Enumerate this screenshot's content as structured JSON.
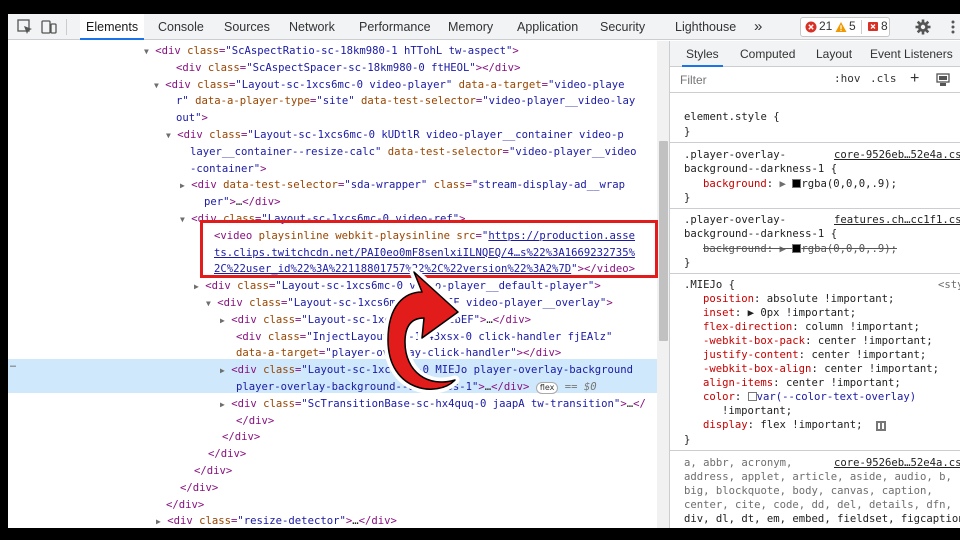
{
  "toolbar": {
    "tabs": [
      "Elements",
      "Console",
      "Sources",
      "Network",
      "Performance",
      "Memory",
      "Application",
      "Security",
      "Lighthouse"
    ],
    "more": "»",
    "errors": "21",
    "warnings": "5",
    "issues": "8"
  },
  "elements": {
    "lines": [
      {
        "ind": 146,
        "tri": "▼",
        "html": "<span class='tag'>&lt;div</span> <span class='an'>class</span>=<span class='av'>\"ScAspectRatio-sc-18km980-1 hTTohL tw-aspect\"</span><span class='tag'>&gt;</span>"
      },
      {
        "ind": 168,
        "tri": "",
        "html": "<span class='tag'>&lt;div</span> <span class='an'>class</span>=<span class='av'>\"ScAspectSpacer-sc-18km980-0 ftHEOL\"</span><span class='tag'>&gt;&lt;/div&gt;</span>"
      },
      {
        "ind": 156,
        "tri": "▼",
        "html": "<span class='tag'>&lt;div</span> <span class='an'>class</span>=<span class='av'>\"Layout-sc-1xcs6mc-0 video-player\"</span> <span class='an'>data-a-target</span>=<span class='av'>\"video-playe</span>"
      },
      {
        "ind": 168,
        "tri": "",
        "html": "<span class='av'>r\"</span> <span class='an'>data-a-player-type</span>=<span class='av'>\"site\"</span> <span class='an'>data-test-selector</span>=<span class='av'>\"video-player__video-lay</span>"
      },
      {
        "ind": 168,
        "tri": "",
        "html": "<span class='av'>out\"</span><span class='tag'>&gt;</span>"
      },
      {
        "ind": 168,
        "tri": "▼",
        "html": "<span class='tag'>&lt;div</span> <span class='an'>class</span>=<span class='av'>\"Layout-sc-1xcs6mc-0 kUDtlR video-player__container video-p</span>"
      },
      {
        "ind": 182,
        "tri": "",
        "html": "<span class='av'>layer__container--resize-calc\"</span> <span class='an'>data-test-selector</span>=<span class='av'>\"video-player__video</span>"
      },
      {
        "ind": 182,
        "tri": "",
        "html": "<span class='av'>-container\"</span><span class='tag'>&gt;</span>"
      },
      {
        "ind": 182,
        "tri": "▶",
        "html": "<span class='tag'>&lt;div</span> <span class='an'>data-test-selector</span>=<span class='av'>\"sda-wrapper\"</span> <span class='an'>class</span>=<span class='av'>\"stream-display-ad__wrap</span>"
      },
      {
        "ind": 196,
        "tri": "",
        "html": "<span class='av'>per\"</span><span class='tag'>&gt;</span><span class='txt'>…</span><span class='tag'>&lt;/div&gt;</span>"
      },
      {
        "ind": 182,
        "tri": "▼",
        "html": "<span class='tag'>&lt;div</span> <span class='an'>class</span>=<span class='av'>\"Layout-sc-1xcs6mc-0 video-ref\"</span><span class='tag'>&gt;</span>"
      },
      {
        "ind": 206,
        "tri": "",
        "html": "<span class='tag'>&lt;video</span> <span class='an'>playsinline webkit-playsinline src</span>=<span class='av'>\"</span><span class='lnk'>https://production.asse</span>"
      },
      {
        "ind": 206,
        "tri": "",
        "html": "<span class='lnk'>ts.clips.twitchcdn.net/PAI0eo0mF8senlxiILNQEQ/4…s%22%3A1669232735%</span>"
      },
      {
        "ind": 206,
        "tri": "",
        "html": "<span class='lnk'>2C%22user_id%22%3A%22118801757%22%2C%22version%22%3A2%7D</span><span class='av'>\"</span><span class='tag'>&gt;&lt;/video&gt;</span>"
      },
      {
        "ind": 196,
        "tri": "▶",
        "html": "<span class='tag'>&lt;div</span> <span class='an'>class</span>=<span class='av'>\"Layout-sc-1xcs6mc-0 video-player__default-player\"</span><span class='tag'>&gt;</span>"
      },
      {
        "ind": 208,
        "tri": "▼",
        "html": "<span class='tag'>&lt;div</span> <span class='an'>class</span>=<span class='av'>\"Layout-sc-1xcs6mc-0 kfOuIF video-player__overlay\"</span><span class='tag'>&gt;</span>"
      },
      {
        "ind": 222,
        "tri": "▶",
        "html": "<span class='tag'>&lt;div</span> <span class='an'>class</span>=<span class='av'>\"Layout-sc-1xcs6mc-0 fYzbEF\"</span><span class='tag'>&gt;</span><span class='txt'>…</span><span class='tag'>&lt;/div&gt;</span>"
      },
      {
        "ind": 228,
        "tri": "",
        "html": "<span class='tag'>&lt;div</span> <span class='an'>class</span>=<span class='av'>\"InjectLayout-sc-1i43xsx-0 click-handler fjEAlz\"</span>"
      },
      {
        "ind": 228,
        "tri": "",
        "html": "<span class='an'>data-a-target</span>=<span class='av'>\"player-overlay-click-handler\"</span><span class='tag'>&gt;&lt;/div&gt;</span>"
      },
      {
        "ind": 222,
        "tri": "▶",
        "html": "<span class='tag'>&lt;div</span> <span class='an'>class</span>=<span class='av'>\"Layout-sc-1xcs6mc-0 MIEJo player-overlay-background</span>"
      },
      {
        "ind": 228,
        "tri": "",
        "html": "<span class='av'>player-overlay-background--darkness-1\"</span><span class='tag'>&gt;</span><span class='txt'>…</span><span class='tag'>&lt;/div&gt;</span> <span class='flexbadge'>flex</span> <span class='eq'>== $0</span>"
      },
      {
        "ind": 222,
        "tri": "▶",
        "html": "<span class='tag'>&lt;div</span> <span class='an'>class</span>=<span class='av'>\"ScTransitionBase-sc-hx4quq-0 jaapA tw-transition\"</span><span class='tag'>&gt;</span><span class='txt'>…</span><span class='tag'>&lt;/</span>"
      },
      {
        "ind": 228,
        "tri": "",
        "html": "<span class='tag'>&lt;/div&gt;</span>"
      },
      {
        "ind": 214,
        "tri": "",
        "html": "<span class='tag'>&lt;/div&gt;</span>"
      },
      {
        "ind": 200,
        "tri": "",
        "html": "<span class='tag'>&lt;/div&gt;</span>"
      },
      {
        "ind": 186,
        "tri": "",
        "html": "<span class='tag'>&lt;/div&gt;</span>"
      },
      {
        "ind": 172,
        "tri": "",
        "html": "<span class='tag'>&lt;/div&gt;</span>"
      },
      {
        "ind": 158,
        "tri": "",
        "html": "<span class='tag'>&lt;/div&gt;</span>"
      },
      {
        "ind": 158,
        "tri": "▶",
        "html": "<span class='tag'>&lt;div</span> <span class='an'>class</span>=<span class='av'>\"resize-detector\"</span><span class='tag'>&gt;</span><span class='txt'>…</span><span class='tag'>&lt;/div&gt;</span>"
      }
    ],
    "ellipsis": "…"
  },
  "styles": {
    "subtabs": [
      "Styles",
      "Computed",
      "Layout",
      "Event Listeners"
    ],
    "filter_placeholder": "Filter",
    "hov": ":hov",
    "cls": ".cls",
    "add": "+",
    "element_style": "element.style {",
    "brace_close": "}",
    "rule1_sel1": ".player-overlay-",
    "rule1_sel2": "background--darkness-1 {",
    "rule1_src": "core-9526eb…52e4a.css:1",
    "rule1_prop": "background",
    "rule1_val": "rgba(0,0,0,.9);",
    "rule2_sel1": ".player-overlay-",
    "rule2_sel2": "background--darkness-1 {",
    "rule2_src": "features.ch…cc1f1.css:1",
    "rule2_prop": "background",
    "rule2_val": "rgba(0,0,0,.9);",
    "rule3_sel": ".MIEJo {",
    "rule3_src": "<style>",
    "rule3_props": [
      {
        "p": "position",
        "v": "absolute !important;"
      },
      {
        "p": "inset",
        "v": "▶ 0px !important;"
      },
      {
        "p": "flex-direction",
        "v": "column !important;"
      },
      {
        "p": "-webkit-box-pack",
        "v": "center !important;"
      },
      {
        "p": "justify-content",
        "v": "center !important;"
      },
      {
        "p": "-webkit-box-align",
        "v": "center !important;"
      },
      {
        "p": "align-items",
        "v": "center !important;"
      },
      {
        "p": "color",
        "v": "var(--color-text-overlay)"
      },
      {
        "p": "",
        "v": "!important;"
      },
      {
        "p": "display",
        "v": "flex !important;"
      }
    ],
    "ua_src": "core-9526eb…52e4a.css:1",
    "ua_lines": [
      "a, abbr, acronym,",
      "address, applet, article, aside, audio, b,",
      "big, blockquote, body, canvas, caption,",
      "center, cite, code, dd, del, details, dfn,",
      "div, dl, dt, em, embed, fieldset, figcaption,",
      "figure, footer, form, h1, h2, h3, h4, h5, h6,"
    ]
  },
  "colors": {
    "annotation_red": "#e21b1b",
    "accent_blue": "#1a73e8",
    "selection": "#cfe8fc"
  }
}
